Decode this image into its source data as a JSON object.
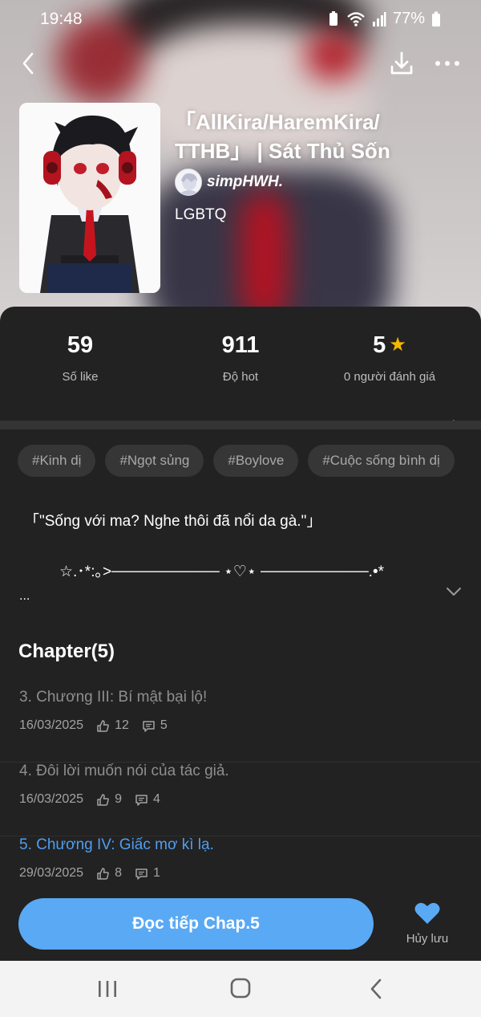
{
  "status_bar": {
    "time": "19:48",
    "battery": "77%"
  },
  "story": {
    "title": "「AllKira/HaremKira/\nTTHB」 | Sát Thủ Sốn",
    "author": "simpHWH.",
    "genre": "LGBTQ"
  },
  "stats": [
    {
      "value": "59",
      "label": "Số like"
    },
    {
      "value": "911",
      "label": "Độ hot"
    },
    {
      "value": "5",
      "label": "0 người đánh giá"
    }
  ],
  "tags": [
    "#Kinh dị",
    "#Ngọt sủng",
    "#Boylove",
    "#Cuộc sống bình dị"
  ],
  "description": {
    "line1": "「\"Sống với ma? Nghe thôi đã nổi da gà.\"」",
    "line2": "☆.･*:｡>────────── ⋆♡⋆ ──────────.•*",
    "more": "..."
  },
  "chapters": {
    "header": "Chapter(5)",
    "items": [
      {
        "title": "3. Chương III: Bí mật bại lộ!",
        "date": "16/03/2025",
        "likes": "12",
        "comments": "5",
        "current": false
      },
      {
        "title": "4. Đôi lời muốn nói của tác giả.",
        "date": "16/03/2025",
        "likes": "9",
        "comments": "4",
        "current": false
      },
      {
        "title": "5. Chương IV: Giấc mơ kì lạ.",
        "date": "29/03/2025",
        "likes": "8",
        "comments": "1",
        "current": true
      }
    ]
  },
  "actions": {
    "read_label": "Đọc tiếp Chap.5",
    "unsave_label": "Hủy lưu"
  },
  "colors": {
    "accent": "#5aa9f4",
    "current_chapter": "#4f9ef0",
    "star": "#f5b800",
    "panel": "#222222"
  },
  "icons": [
    "back-icon",
    "download-icon",
    "more-icon",
    "star-icon",
    "chevron-right-icon",
    "chevron-down-icon",
    "like-icon",
    "comment-icon",
    "heart-icon",
    "recents-icon",
    "home-icon",
    "back-nav-icon"
  ]
}
